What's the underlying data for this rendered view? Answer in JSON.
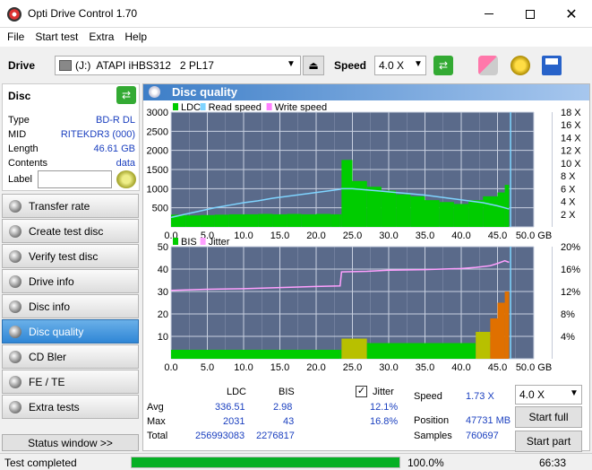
{
  "window": {
    "title": "Opti Drive Control 1.70"
  },
  "menu": [
    "File",
    "Start test",
    "Extra",
    "Help"
  ],
  "toolbar": {
    "drive_label": "Drive",
    "drive_value": "(J:)  ATAPI iHBS312   2 PL17",
    "speed_label": "Speed",
    "speed_value": "4.0 X"
  },
  "disc": {
    "header": "Disc",
    "rows": [
      {
        "k": "Type",
        "v": "BD-R DL"
      },
      {
        "k": "MID",
        "v": "RITEKDR3 (000)"
      },
      {
        "k": "Length",
        "v": "46.61 GB"
      },
      {
        "k": "Contents",
        "v": "data"
      }
    ],
    "label_key": "Label",
    "label_value": ""
  },
  "sidebar": {
    "items": [
      "Transfer rate",
      "Create test disc",
      "Verify test disc",
      "Drive info",
      "Disc info",
      "Disc quality",
      "CD Bler",
      "FE / TE",
      "Extra tests"
    ],
    "active": 5,
    "status_window": "Status window >>"
  },
  "panel": {
    "title": "Disc quality"
  },
  "chart_data": [
    {
      "type": "area",
      "legend": [
        "LDC",
        "Read speed",
        "Write speed"
      ],
      "y_left_ticks": [
        "3000",
        "2500",
        "2000",
        "1500",
        "1000",
        "500"
      ],
      "y_right_ticks": [
        "18 X",
        "16 X",
        "14 X",
        "12 X",
        "10 X",
        "8 X",
        "6 X",
        "4 X",
        "2 X"
      ],
      "x_ticks": [
        "0.0",
        "5.0",
        "10.0",
        "15.0",
        "20.0",
        "25.0",
        "30.0",
        "35.0",
        "40.0",
        "45.0",
        "50.0 GB"
      ],
      "ylim": [
        0,
        3000
      ],
      "xlim": [
        0,
        50
      ],
      "x": [
        0,
        2,
        4,
        6,
        8,
        10,
        12,
        14,
        16,
        18,
        20,
        22,
        23.3,
        23.5,
        25,
        27,
        29,
        31,
        33,
        35,
        37,
        39,
        41,
        43,
        45,
        46,
        46.6
      ],
      "ldc": [
        320,
        300,
        310,
        320,
        330,
        330,
        340,
        330,
        340,
        330,
        340,
        330,
        330,
        1750,
        1200,
        1050,
        950,
        850,
        800,
        700,
        650,
        600,
        700,
        800,
        900,
        1100,
        800
      ],
      "read_speed_x": [
        1.5,
        2.0,
        2.5,
        3.0,
        3.4,
        3.8,
        4.1,
        4.5,
        4.8,
        5.1,
        5.4,
        5.7,
        5.9,
        6.0,
        6.0,
        5.8,
        5.6,
        5.4,
        5.2,
        5.0,
        4.7,
        4.4,
        4.1,
        3.8,
        3.3,
        3.0,
        2.8
      ],
      "colors": {
        "ldc": "#00cc00",
        "read": "#7fd4ff",
        "write": "#ff80ff"
      }
    },
    {
      "type": "area",
      "legend": [
        "BIS",
        "Jitter"
      ],
      "y_left_ticks": [
        "50",
        "40",
        "30",
        "20",
        "10"
      ],
      "y_right_ticks": [
        "20%",
        "16%",
        "12%",
        "8%",
        "4%"
      ],
      "x_ticks": [
        "0.0",
        "5.0",
        "10.0",
        "15.0",
        "20.0",
        "25.0",
        "30.0",
        "35.0",
        "40.0",
        "45.0",
        "50.0 GB"
      ],
      "ylim": [
        0,
        50
      ],
      "xlim": [
        0,
        50
      ],
      "x": [
        0,
        5,
        10,
        15,
        20,
        23.3,
        23.5,
        27,
        30,
        35,
        40,
        42,
        44,
        45,
        46,
        46.6
      ],
      "bis": [
        4,
        4,
        4,
        4,
        4,
        4,
        9,
        7,
        7,
        7,
        7,
        12,
        18,
        25,
        30,
        20
      ],
      "jitter_pct": [
        12.2,
        12.4,
        12.5,
        12.7,
        12.9,
        13.0,
        15.5,
        15.6,
        15.8,
        15.9,
        16.1,
        16.3,
        16.6,
        17.0,
        17.5,
        17.2
      ],
      "colors": {
        "bis": "#00cc00",
        "jitter": "#ffa0ff"
      }
    }
  ],
  "stats": {
    "col_ldc": "LDC",
    "col_bis": "BIS",
    "jitter_label": "Jitter",
    "jitter_checked": true,
    "rows": [
      {
        "k": "Avg",
        "ldc": "336.51",
        "bis": "2.98",
        "jit": "12.1%"
      },
      {
        "k": "Max",
        "ldc": "2031",
        "bis": "43",
        "jit": "16.8%"
      },
      {
        "k": "Total",
        "ldc": "256993083",
        "bis": "2276817",
        "jit": ""
      }
    ],
    "speed_label": "Speed",
    "speed_value": "1.73 X",
    "position_label": "Position",
    "position_value": "47731 MB",
    "samples_label": "Samples",
    "samples_value": "760697",
    "speed_select": "4.0 X",
    "start_full": "Start full",
    "start_part": "Start part"
  },
  "status": {
    "text": "Test completed",
    "progress": 100.0,
    "progress_text": "100.0%",
    "time": "66:33"
  }
}
